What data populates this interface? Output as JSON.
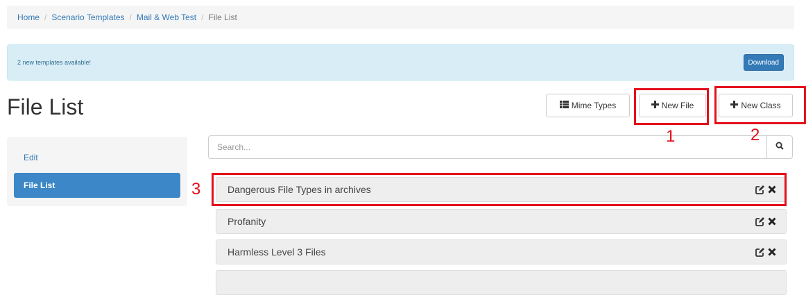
{
  "breadcrumb": {
    "items": [
      {
        "label": "Home"
      },
      {
        "label": "Scenario Templates"
      },
      {
        "label": "Mail & Web Test"
      },
      {
        "label": "File List"
      }
    ],
    "separator": "/"
  },
  "alert": {
    "text": "2 new templates available!",
    "button_label": "Download"
  },
  "page_title": "File List",
  "toolbar": {
    "mime_types_label": "Mime Types",
    "new_file_label": "New File",
    "new_class_label": "New Class"
  },
  "sidebar": {
    "items": [
      {
        "label": "Edit",
        "active": false
      },
      {
        "label": "File List",
        "active": true
      }
    ]
  },
  "search": {
    "placeholder": "Search...",
    "value": ""
  },
  "file_list": {
    "items": [
      {
        "name": "Dangerous File Types in archives"
      },
      {
        "name": "Profanity"
      },
      {
        "name": "Harmless Level 3 Files"
      }
    ]
  },
  "annotations": [
    "1",
    "2",
    "3"
  ],
  "colors": {
    "accent": "#337ab7",
    "active_nav": "#3c87c7",
    "alert_bg": "#d9edf7",
    "annotation_red": "#e3101b"
  }
}
